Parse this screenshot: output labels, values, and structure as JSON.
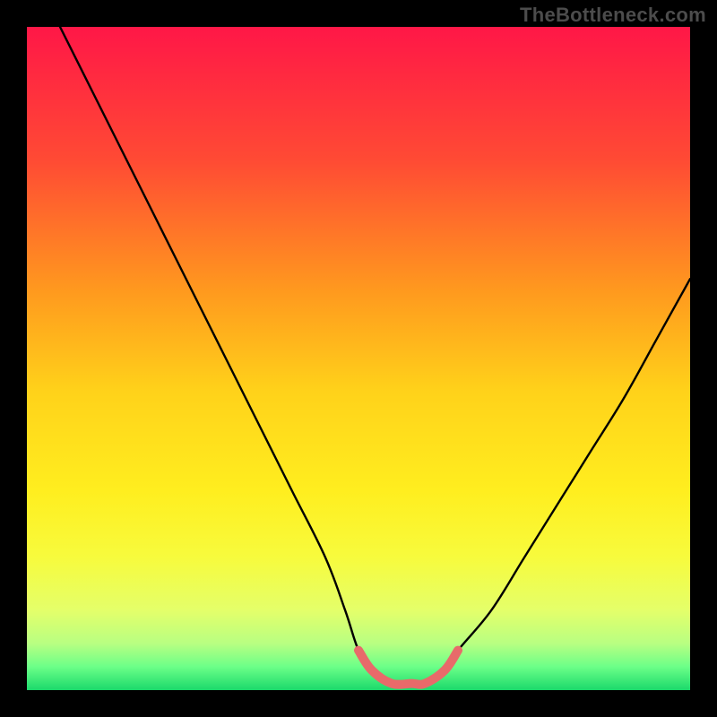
{
  "watermark": "TheBottleneck.com",
  "chart_data": {
    "type": "line",
    "title": "",
    "xlabel": "",
    "ylabel": "",
    "xlim": [
      0,
      100
    ],
    "ylim": [
      0,
      100
    ],
    "series": [
      {
        "name": "bottleneck-curve",
        "x": [
          5,
          10,
          15,
          20,
          25,
          30,
          35,
          40,
          45,
          48,
          50,
          52,
          55,
          58,
          60,
          63,
          65,
          70,
          75,
          80,
          85,
          90,
          95,
          100
        ],
        "values": [
          100,
          90,
          80,
          70,
          60,
          50,
          40,
          30,
          20,
          12,
          6,
          3,
          1,
          1,
          1,
          3,
          6,
          12,
          20,
          28,
          36,
          44,
          53,
          62
        ]
      }
    ],
    "highlight_segment": {
      "x": [
        50,
        52,
        55,
        58,
        60,
        63,
        65
      ],
      "values": [
        6,
        3,
        1,
        1,
        1,
        3,
        6
      ]
    },
    "gradient_stops": [
      {
        "offset": 0.0,
        "color": "#ff1747"
      },
      {
        "offset": 0.2,
        "color": "#ff4a34"
      },
      {
        "offset": 0.4,
        "color": "#ff9a1e"
      },
      {
        "offset": 0.55,
        "color": "#ffd21a"
      },
      {
        "offset": 0.7,
        "color": "#ffee1f"
      },
      {
        "offset": 0.8,
        "color": "#f7fb3d"
      },
      {
        "offset": 0.88,
        "color": "#e4ff6a"
      },
      {
        "offset": 0.93,
        "color": "#b8ff82"
      },
      {
        "offset": 0.965,
        "color": "#6bff88"
      },
      {
        "offset": 1.0,
        "color": "#1bd96b"
      }
    ]
  }
}
